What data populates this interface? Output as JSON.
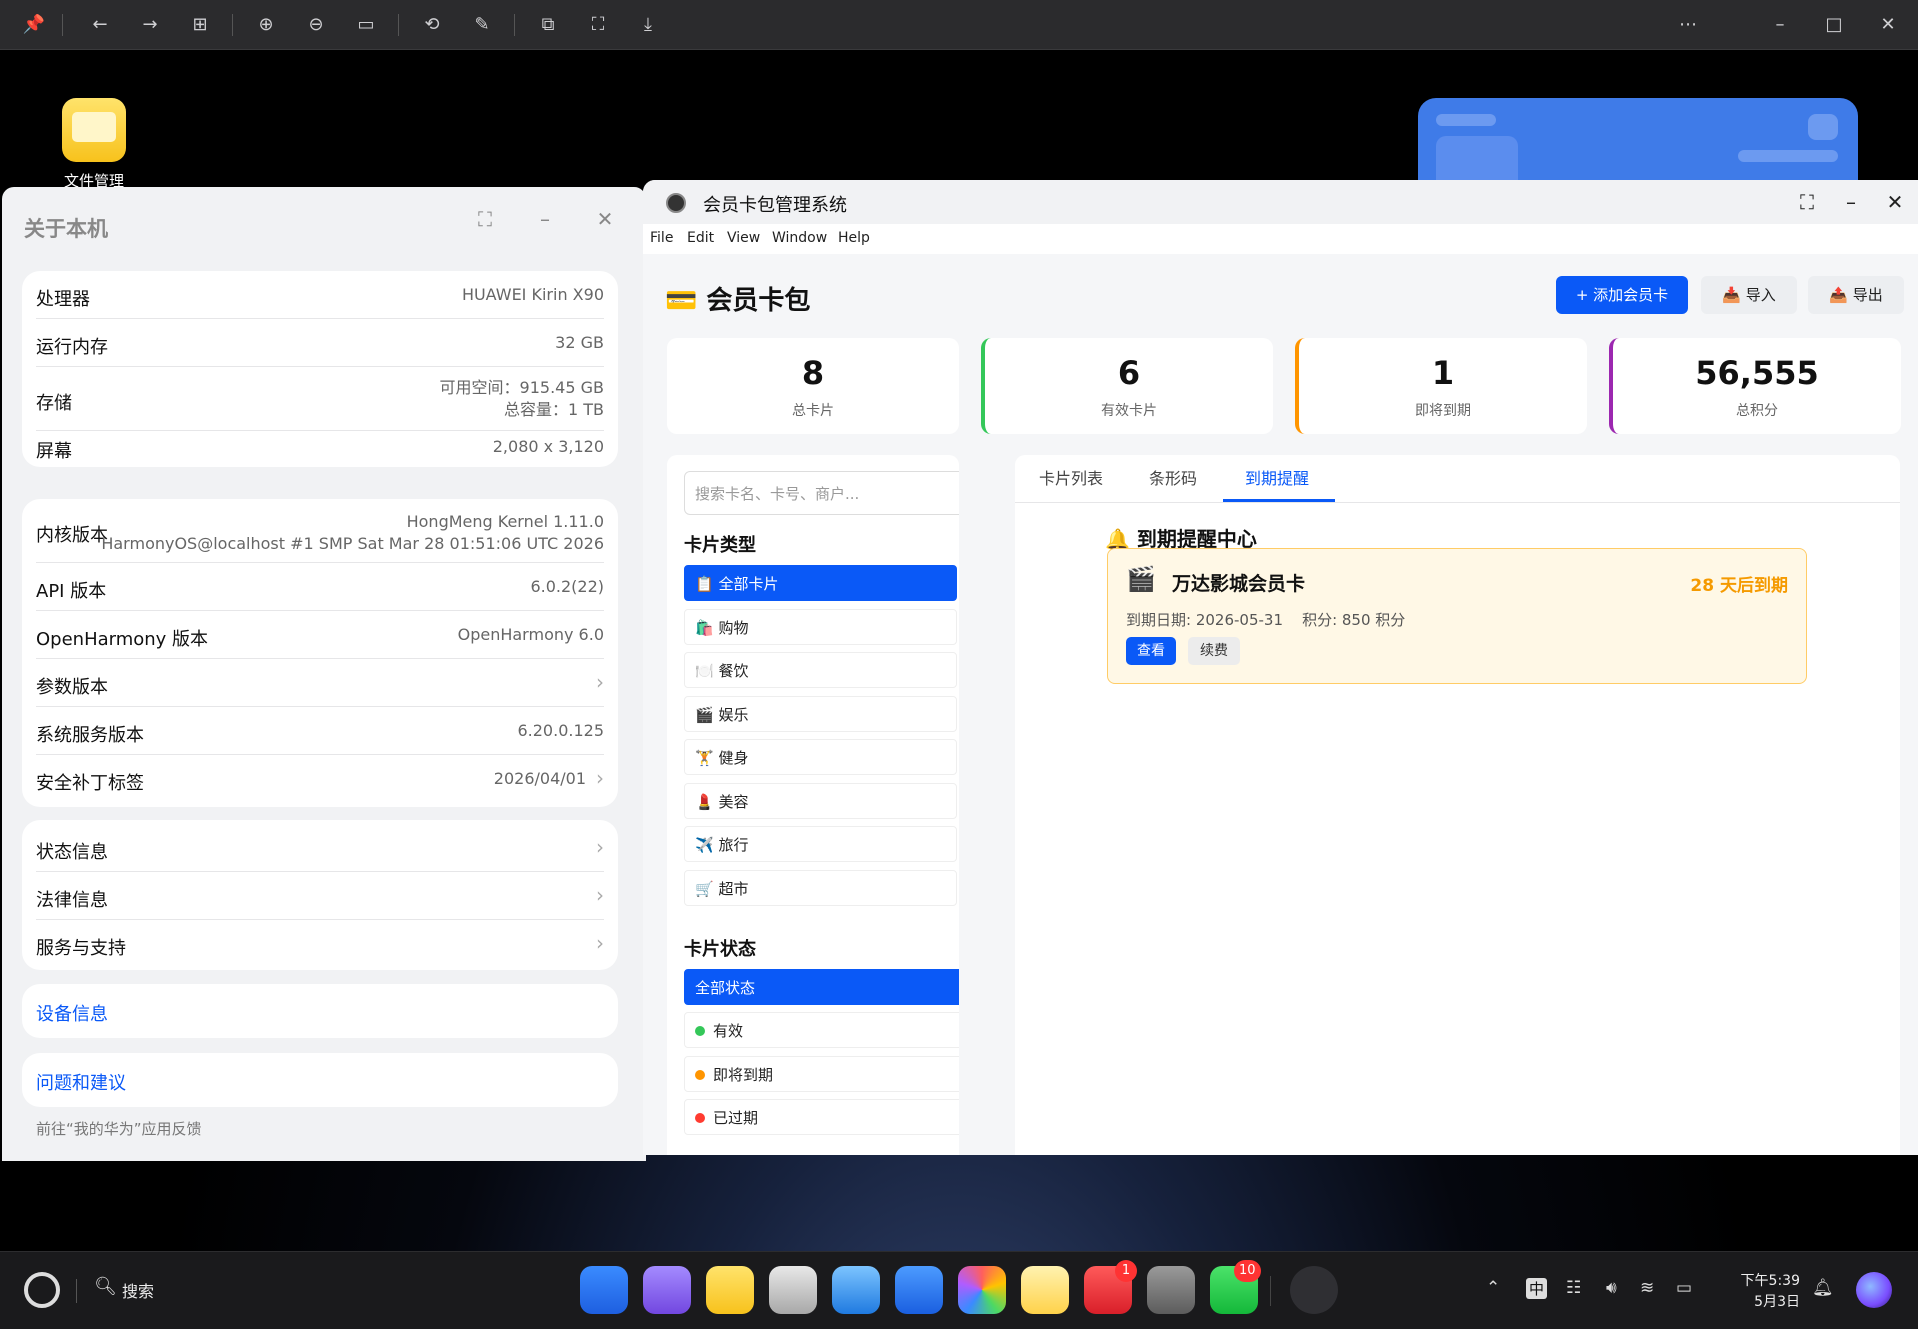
{
  "desktop": {
    "file_manager_label": "文件管理"
  },
  "about": {
    "title": "关于本机",
    "hardware": [
      {
        "key": "处理器",
        "value": "HUAWEI Kirin X90"
      },
      {
        "key": "运行内存",
        "value": "32 GB"
      },
      {
        "key": "存储",
        "value1": "可用空间：915.45 GB",
        "value2": "总容量：1 TB"
      },
      {
        "key": "屏幕",
        "value": "2,080 x 3,120"
      }
    ],
    "software": [
      {
        "key": "内核版本",
        "value1": "HongMeng Kernel 1.11.0",
        "value2": "HarmonyOS@localhost #1 SMP Sat Mar 28 01:51:06 UTC 2026"
      },
      {
        "key": "API 版本",
        "value": "6.0.2(22)"
      },
      {
        "key": "OpenHarmony 版本",
        "value": "OpenHarmony 6.0"
      },
      {
        "key": "参数版本",
        "value": ""
      },
      {
        "key": "系统服务版本",
        "value": "6.20.0.125"
      },
      {
        "key": "安全补丁标签",
        "value": "2026/04/01"
      }
    ],
    "info": [
      {
        "key": "状态信息"
      },
      {
        "key": "法律信息"
      },
      {
        "key": "服务与支持"
      }
    ],
    "device_info": "设备信息",
    "feedback": "问题和建议",
    "feedback_hint": "前往“我的华为”应用反馈"
  },
  "app": {
    "window_title": "会员卡包管理系统",
    "menu": [
      "File",
      "Edit",
      "View",
      "Window",
      "Help"
    ],
    "header_title": "💳 会员卡包",
    "add_button": "+ 添加会员卡",
    "import_button": "📥 导入",
    "export_button": "📤 导出",
    "stats": [
      {
        "num": "8",
        "label": "总卡片",
        "color": "#ffffff"
      },
      {
        "num": "6",
        "label": "有效卡片",
        "color": "#34c759"
      },
      {
        "num": "1",
        "label": "即将到期",
        "color": "#ff9500"
      },
      {
        "num": "56,555",
        "label": "总积分",
        "color": "#9c27b0"
      }
    ],
    "search_placeholder": "搜索卡名、卡号、商户...",
    "card_type_title": "卡片类型",
    "card_types": [
      "📋 全部卡片",
      "🛍️ 购物",
      "🍽️ 餐饮",
      "🎬 娱乐",
      "🏋️ 健身",
      "💄 美容",
      "✈️ 旅行",
      "🛒 超市"
    ],
    "card_status_title": "卡片状态",
    "card_statuses": [
      {
        "label": "全部状态",
        "dot": ""
      },
      {
        "label": "有效",
        "dot": "#34c759"
      },
      {
        "label": "即将到期",
        "dot": "#ff9500"
      },
      {
        "label": "已过期",
        "dot": "#ff3b30"
      }
    ],
    "tabs": [
      "卡片列表",
      "条形码",
      "到期提醒"
    ],
    "reminder_title": "🔔 到期提醒中心",
    "reminder": {
      "icon": "🎬",
      "name": "万达影城会员卡",
      "days": "28 天后到期",
      "info": "到期日期: 2026-05-31    积分: 850 积分",
      "view": "查看",
      "renew": "续费"
    }
  },
  "taskbar": {
    "search": "搜索",
    "appgallery_badge": "1",
    "wechat_badge": "10",
    "ime": "中",
    "time": "下午5:39",
    "date": "5月3日"
  }
}
